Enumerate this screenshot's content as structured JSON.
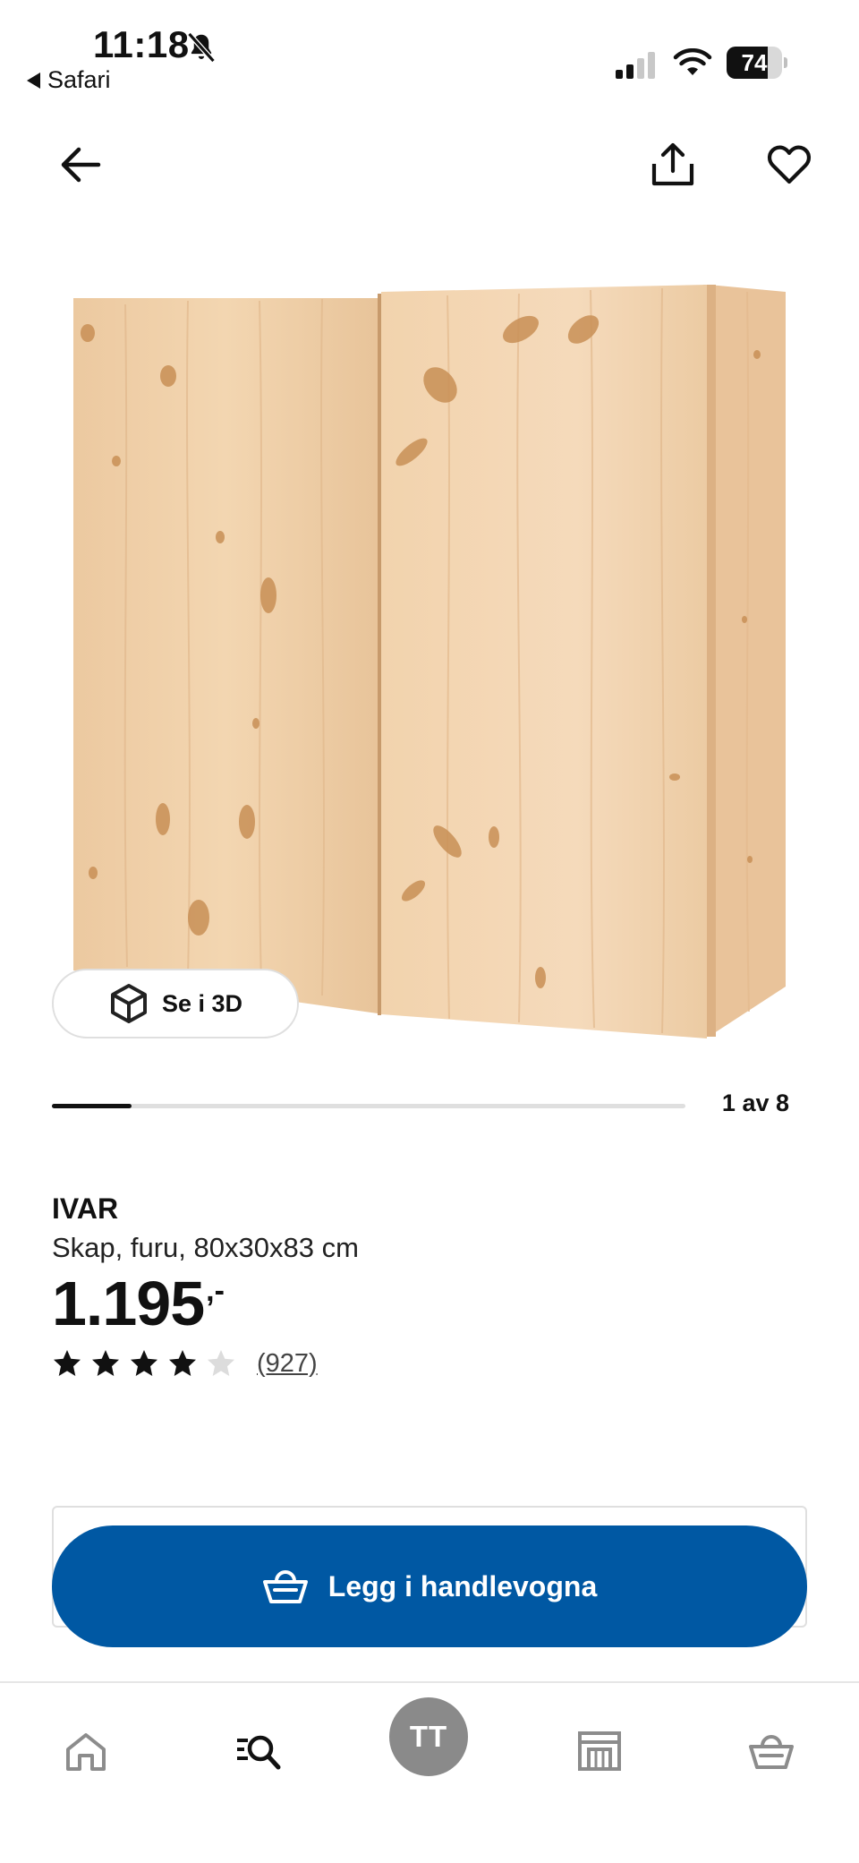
{
  "status_bar": {
    "time": "11:18",
    "back_app_label": "Safari",
    "battery_percent": "74",
    "battery_level": 0.74,
    "signal_bars_active": 2,
    "icons": [
      "bell-slash-icon",
      "cellular-signal-icon",
      "wifi-icon",
      "battery-icon"
    ]
  },
  "top_nav": {
    "icons": [
      "back-arrow-icon",
      "share-icon",
      "heart-icon"
    ]
  },
  "gallery": {
    "view_3d_label": "Se i 3D",
    "page_indicator": "1 av 8",
    "current_index": 1,
    "total_images": 8,
    "progress_fraction": 0.125
  },
  "product": {
    "name": "IVAR",
    "description": "Skap, furu, 80x30x83 cm",
    "price": "1.195",
    "price_suffix": ",-",
    "rating": 4,
    "rating_max": 5,
    "review_count": "(927)"
  },
  "actions": {
    "add_to_cart_label": "Legg i handlevogna"
  },
  "tab_bar": {
    "avatar_initials": "TT",
    "active_tab": "search",
    "tabs": [
      "home-icon",
      "search-icon",
      "profile-avatar",
      "store-icon",
      "cart-basket-icon"
    ]
  },
  "colors": {
    "primary_blue": "#0058a3",
    "text": "#111111",
    "track": "#dfdfdf",
    "avatar_bg": "#8a8a8a",
    "tab_icon_inactive": "#8c8c8c"
  }
}
